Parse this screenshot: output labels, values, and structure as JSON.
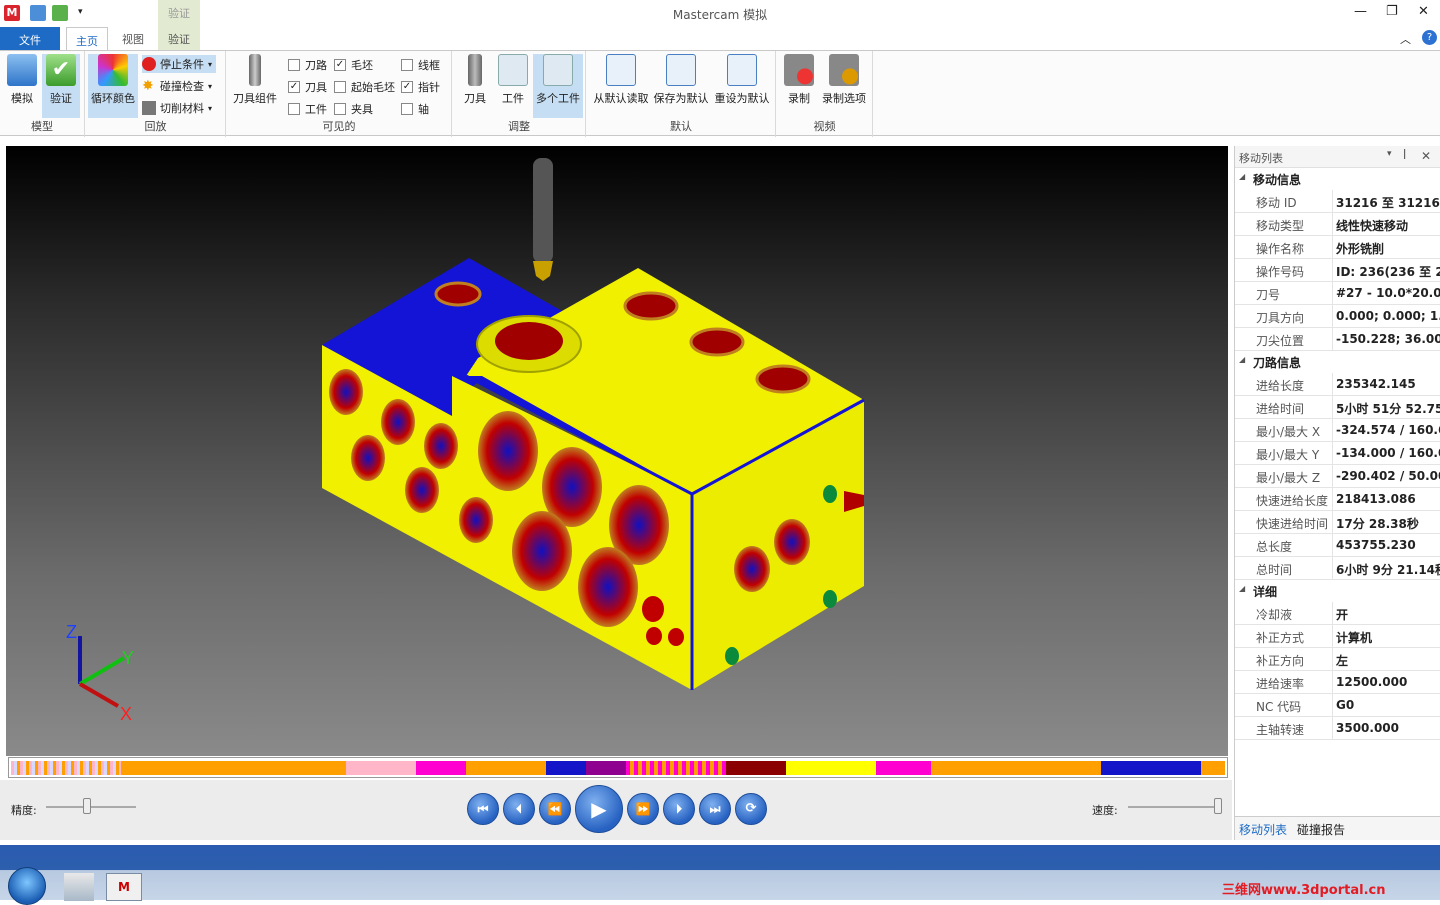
{
  "window": {
    "title": "Mastercam 模拟",
    "contextual_tab_group": "验证"
  },
  "tabs": {
    "file": "文件",
    "home": "主页",
    "view": "视图",
    "verify": "验证"
  },
  "ribbon": {
    "model": {
      "label": "模型",
      "simulate": "模拟",
      "verify": "验证"
    },
    "playback": {
      "label": "回放",
      "cycle_colors": "循环颜色",
      "stop_condition": "停止条件",
      "collision_check": "碰撞检查",
      "cut_stock": "切削材料"
    },
    "visible": {
      "label": "可见的",
      "tool_assembly": "刀具组件",
      "toolpath": {
        "label": "刀路",
        "checked": false
      },
      "stock": {
        "label": "毛坯",
        "checked": true
      },
      "wireframe": {
        "label": "线框",
        "checked": false
      },
      "tool": {
        "label": "刀具",
        "checked": true
      },
      "initial_stock": {
        "label": "起始毛坯",
        "checked": false
      },
      "pointer": {
        "label": "指针",
        "checked": true
      },
      "workpiece": {
        "label": "工件",
        "checked": false
      },
      "fixture": {
        "label": "夹具",
        "checked": false
      },
      "axis": {
        "label": "轴",
        "checked": false
      }
    },
    "adjust": {
      "label": "调整",
      "tool": "刀具",
      "workpiece": "工件",
      "multiple": "多个工件"
    },
    "defaults": {
      "label": "默认",
      "load": "从默认读取",
      "save": "保存为默认",
      "reset": "重设为默认"
    },
    "video": {
      "label": "视频",
      "record": "录制",
      "record_options": "录制选项"
    }
  },
  "viewport": {
    "axis_x": "X",
    "axis_y": "Y",
    "axis_z": "Z"
  },
  "playback_bar": {
    "precision_label": "精度:",
    "speed_label": "速度:",
    "precision_value": 0.45,
    "speed_value": 1.0
  },
  "panel": {
    "title": "移动列表",
    "sections": [
      {
        "name": "移动信息",
        "rows": [
          {
            "k": "移动 ID",
            "v": "31216 至 31216"
          },
          {
            "k": "移动类型",
            "v": "线性快速移动"
          },
          {
            "k": "操作名称",
            "v": "外形铣削"
          },
          {
            "k": "操作号码",
            "v": "ID: 236(236 至 2"
          },
          {
            "k": "刀号",
            "v": "#27 - 10.0*20.0B"
          },
          {
            "k": "刀具方向",
            "v": "0.000; 0.000; 1.0"
          },
          {
            "k": "刀尖位置",
            "v": "-150.228; 36.000"
          }
        ]
      },
      {
        "name": "刀路信息",
        "rows": [
          {
            "k": "进给长度",
            "v": "235342.145"
          },
          {
            "k": "进给时间",
            "v": "5小时 51分 52.75"
          },
          {
            "k": "最小/最大 X",
            "v": "-324.574 / 160.6"
          },
          {
            "k": "最小/最大 Y",
            "v": "-134.000 / 160.0"
          },
          {
            "k": "最小/最大 Z",
            "v": "-290.402 / 50.00"
          },
          {
            "k": "快速进给长度",
            "v": "218413.086"
          },
          {
            "k": "快速进给时间",
            "v": "17分 28.38秒"
          },
          {
            "k": "总长度",
            "v": "453755.230"
          },
          {
            "k": "总时间",
            "v": "6小时 9分 21.14秒"
          }
        ]
      },
      {
        "name": "详细",
        "rows": [
          {
            "k": "冷却液",
            "v": "开"
          },
          {
            "k": "补正方式",
            "v": "计算机"
          },
          {
            "k": "补正方向",
            "v": "左"
          },
          {
            "k": "进给速率",
            "v": "12500.000"
          },
          {
            "k": "NC 代码",
            "v": "G0"
          },
          {
            "k": "主轴转速",
            "v": "3500.000"
          }
        ]
      }
    ],
    "tab_move_list": "移动列表",
    "tab_collision": "碰撞报告"
  },
  "watermark": "三维网www.3dportal.cn",
  "colors": {
    "accent": "#1d6bc4",
    "part_yellow": "#f0f000",
    "part_blue": "#1414d6",
    "holes_red": "#c00000"
  }
}
